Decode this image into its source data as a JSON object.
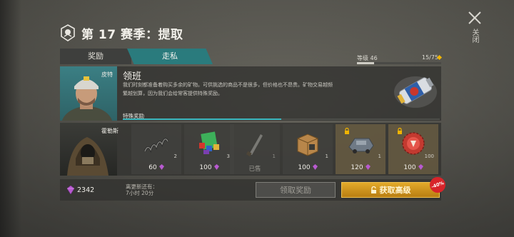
{
  "header": {
    "season_title": "第 17 赛季：提取",
    "close_label": "关闭"
  },
  "tabs": [
    {
      "label": "奖励",
      "active": false
    },
    {
      "label": "走私",
      "active": true
    }
  ],
  "level": {
    "label": "等级 46",
    "count": "15/75",
    "progress": 0.2
  },
  "leader_row": {
    "character_name": "皮特",
    "title": "领班",
    "description": "我们时刻都准备着购买多余的矿物。可供挑选的商品不是很多，但价格也不昂贵。矿物交易越频繁越划算，因为我们会给常客提供特殊奖励。",
    "special_reward_label": "特殊奖励",
    "special_reward_progress": 0.5,
    "reward_icon": "canister-icon"
  },
  "hollis_row": {
    "character_name": "霍勒斯",
    "items": [
      {
        "icon": "spring-icon",
        "qty": "2",
        "price": "60",
        "sold": false,
        "locked": false
      },
      {
        "icon": "books-icon",
        "qty": "3",
        "price": "100",
        "sold": false,
        "locked": false
      },
      {
        "icon": "machete-icon",
        "qty": "1",
        "price": "",
        "sold_label": "已售",
        "sold": true,
        "locked": false
      },
      {
        "icon": "crate-icon",
        "qty": "1",
        "price": "100",
        "sold": false,
        "locked": false
      },
      {
        "icon": "truck-part-icon",
        "qty": "1",
        "price": "120",
        "sold": false,
        "locked": true
      },
      {
        "icon": "bottle-cap-icon",
        "qty": "100",
        "price": "100",
        "sold": false,
        "locked": true
      }
    ]
  },
  "footer": {
    "currency_value": "2342",
    "refresh_line1": "离更新还有：",
    "refresh_line2": "7小时 20分",
    "claim_label": "领取奖励",
    "premium_label": "获取高级",
    "discount_label": "-40%"
  },
  "colors": {
    "accent_teal": "#2a7b7d",
    "premium_gold": "#e2a92a",
    "discount_red": "#d8242a",
    "gem_purple": "#b85ad0"
  }
}
